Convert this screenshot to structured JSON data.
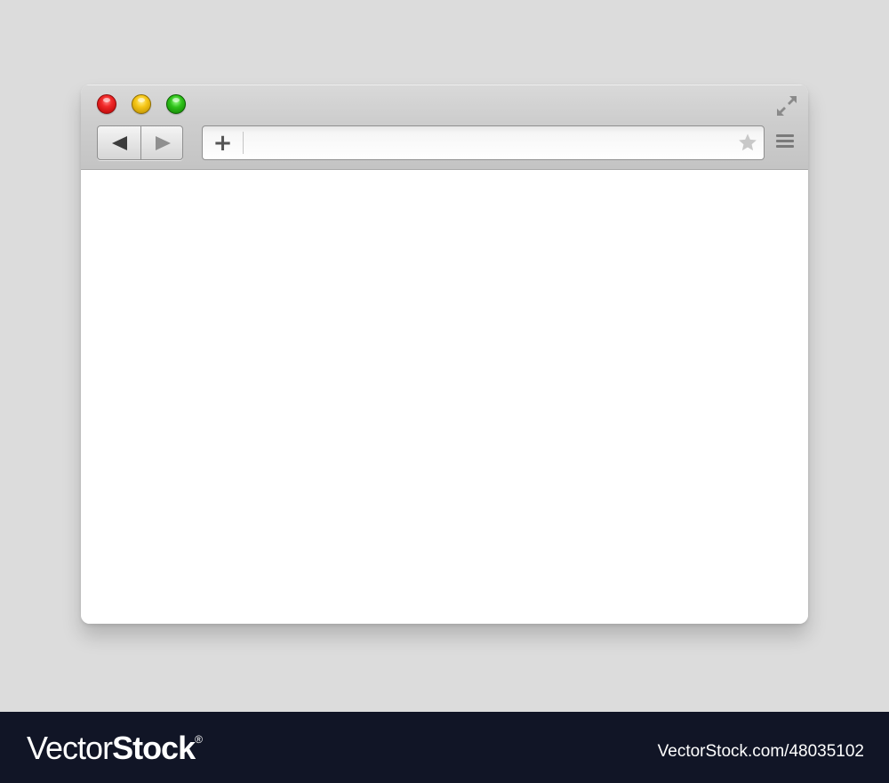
{
  "browser": {
    "window_controls": {
      "close_color": "#e82222",
      "minimize_color": "#f0c000",
      "maximize_color": "#22b000"
    },
    "toolbar": {
      "back_icon": "triangle-left",
      "forward_icon": "triangle-right",
      "add_tab_label": "+",
      "menu_icon": "hamburger",
      "fullscreen_icon": "expand-arrows"
    },
    "address_bar": {
      "value": "",
      "placeholder": "",
      "bookmark_icon": "star"
    },
    "content": {
      "background": "#ffffff"
    }
  },
  "watermark": {
    "logo_part1": "Vector",
    "logo_part2": "Stock",
    "logo_reg": "®",
    "image_id": "VectorStock.com/48035102"
  }
}
